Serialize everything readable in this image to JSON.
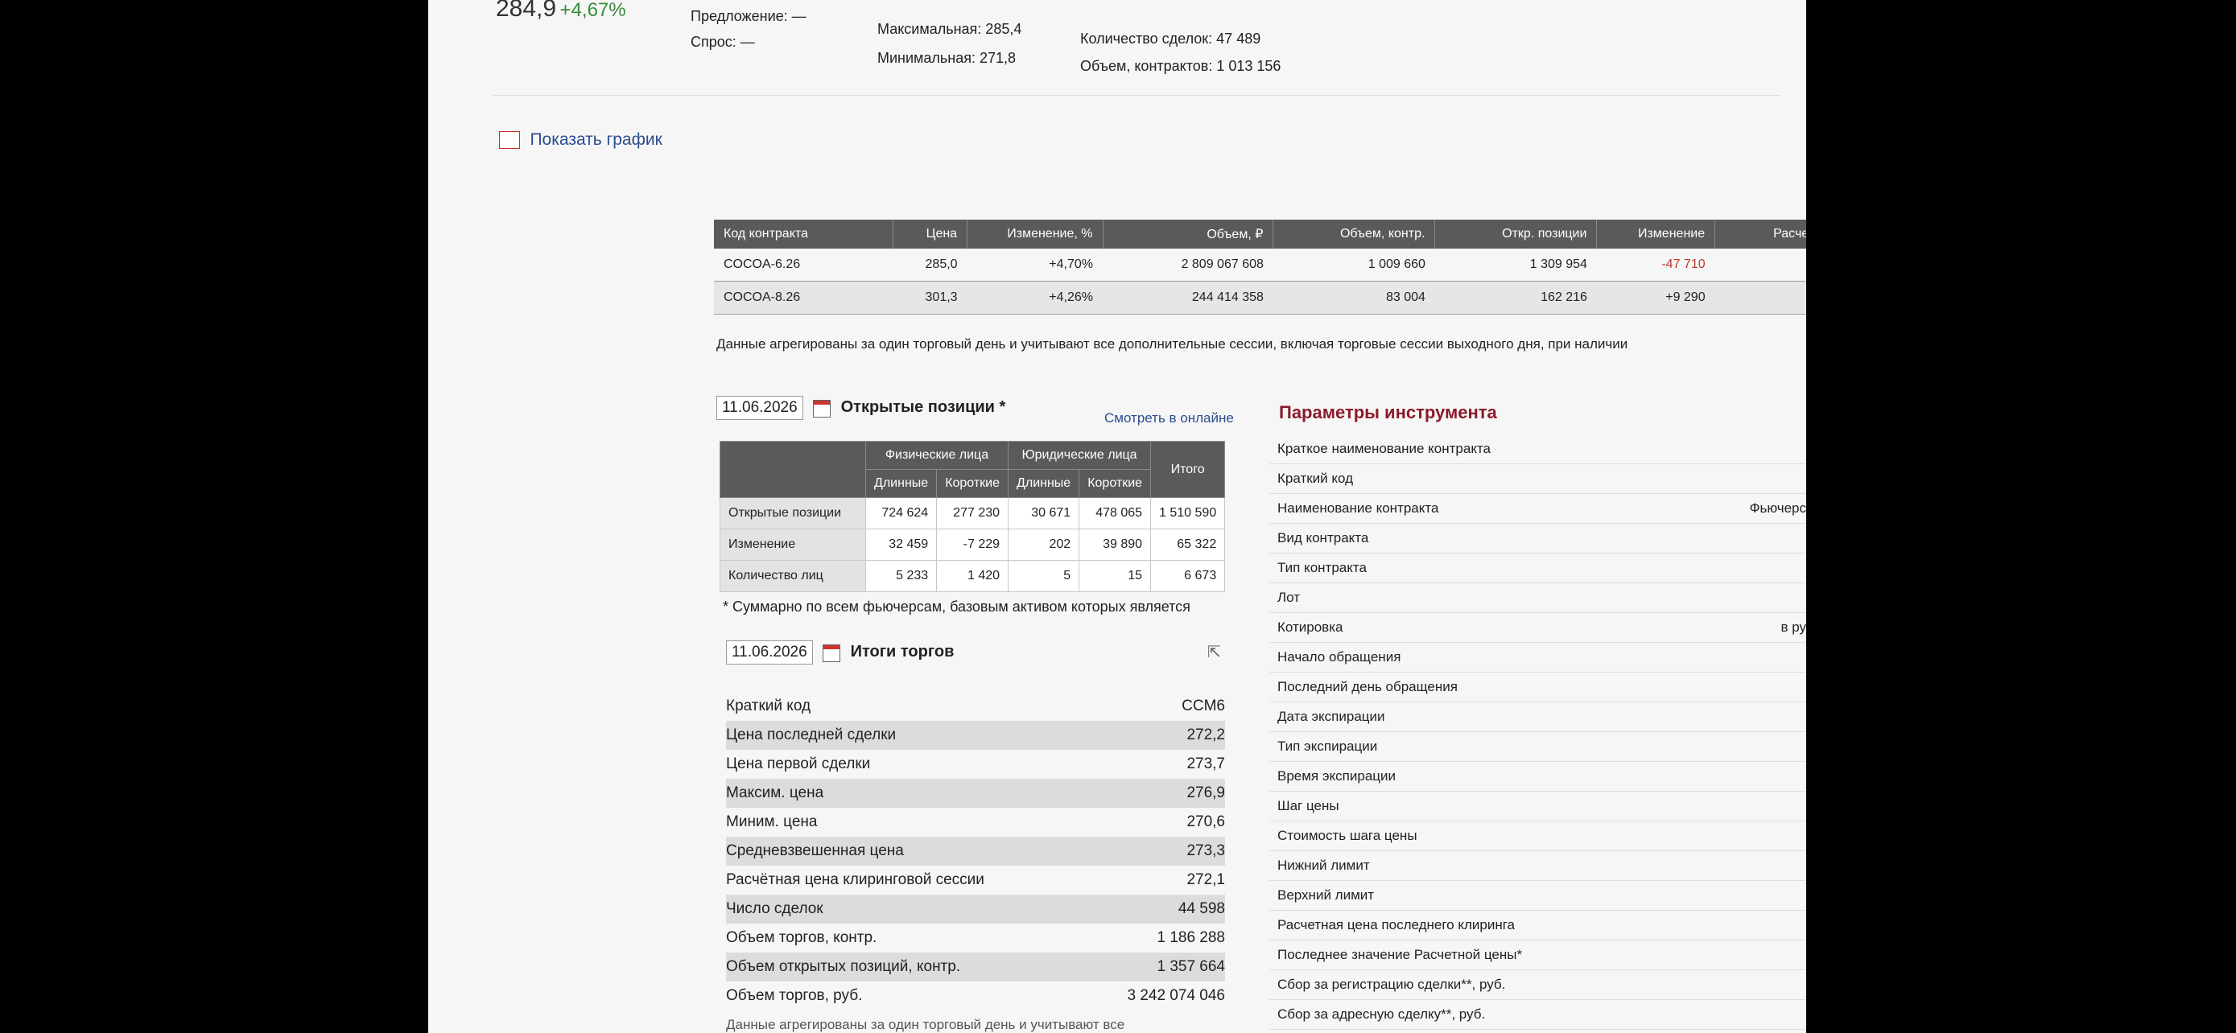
{
  "quote": {
    "price": "284,9",
    "change": "+4,67%",
    "offer_label": "Предложение: —",
    "bid_label": "Спрос: —",
    "max_label": "Максимальная: 285,4",
    "min_label": "Минимальная: 271,8",
    "deals_label": "Количество сделок: 47 489",
    "volume_label": "Объем, контрактов: 1 013 156"
  },
  "chart_link": {
    "label": "Показать график"
  },
  "contracts": {
    "headers": [
      "Код контракта",
      "Цена",
      "Изменение, %",
      "Объем, ₽",
      "Объем, контр.",
      "Откр. позиции",
      "Изменение",
      "Расчет"
    ],
    "rows": [
      [
        "COCOA-6.26",
        "285,0",
        "+4,70%",
        "2 809 067 608",
        "1 009 660",
        "1 309 954",
        "-47 710"
      ],
      [
        "COCOA-8.26",
        "301,3",
        "+4,26%",
        "244 414 358",
        "83 004",
        "162 216",
        "+9 290"
      ]
    ],
    "note": "Данные агрегированы за один торговый день и учитывают все дополнительные сессии, включая торговые сессии выходного дня, при наличии"
  },
  "open_positions": {
    "date": "11.06.2026",
    "title": "Открытые позиции *",
    "online_link": "Смотреть в онлайне",
    "group_headers": [
      "Физические лица",
      "Юридические лица",
      "Итого"
    ],
    "sub_headers": [
      "Длинные",
      "Короткие",
      "Длинные",
      "Короткие"
    ],
    "rows": [
      [
        "Открытые позиции",
        "724 624",
        "277 230",
        "30 671",
        "478 065",
        "1 510 590"
      ],
      [
        "Изменение",
        "32 459",
        "-7 229",
        "202",
        "39 890",
        "65 322"
      ],
      [
        "Количество лиц",
        "5 233",
        "1 420",
        "5",
        "15",
        "6 673"
      ]
    ],
    "footnote": "* Суммарно по всем фьючерсам, базовым активом которых является"
  },
  "trade_results": {
    "date": "11.06.2026",
    "title": "Итоги торгов",
    "rows": [
      [
        "Краткий код",
        "CCM6"
      ],
      [
        "Цена последней сделки",
        "272,2"
      ],
      [
        "Цена первой сделки",
        "273,7"
      ],
      [
        "Максим. цена",
        "276,9"
      ],
      [
        "Миним. цена",
        "270,6"
      ],
      [
        "Средневзвешенная цена",
        "273,3"
      ],
      [
        "Расчётная цена клиринговой сессии",
        "272,1"
      ],
      [
        "Число сделок",
        "44 598"
      ],
      [
        "Объем торгов, контр.",
        "1 186 288"
      ],
      [
        "Объем открытых позиций, контр.",
        "1 357 664"
      ],
      [
        "Объем торгов, руб.",
        "3 242 074 046"
      ]
    ],
    "footnote": "Данные агрегированы за один торговый день и учитывают все"
  },
  "params": {
    "title": "Параметры инструмента",
    "rows": [
      [
        "Краткое наименование контракта",
        ""
      ],
      [
        "Краткий код",
        ""
      ],
      [
        "Наименование контракта",
        "Фьючерс"
      ],
      [
        "Вид контракта",
        ""
      ],
      [
        "Тип контракта",
        ""
      ],
      [
        "Лот",
        ""
      ],
      [
        "Котировка",
        "в ру"
      ],
      [
        "Начало обращения",
        ""
      ],
      [
        "Последний день обращения",
        ""
      ],
      [
        "Дата экспирации",
        ""
      ],
      [
        "Тип экспирации",
        ""
      ],
      [
        "Время экспирации",
        ""
      ],
      [
        "Шаг цены",
        ""
      ],
      [
        "Стоимость шага цены",
        ""
      ],
      [
        "Нижний лимит",
        ""
      ],
      [
        "Верхний лимит",
        ""
      ],
      [
        "Расчетная цена последнего клиринга",
        ""
      ],
      [
        "Последнее значение Расчетной цены*",
        ""
      ],
      [
        "Сбор за регистрацию сделки**, руб.",
        ""
      ],
      [
        "Сбор за адресную сделку**, руб.",
        ""
      ]
    ]
  }
}
